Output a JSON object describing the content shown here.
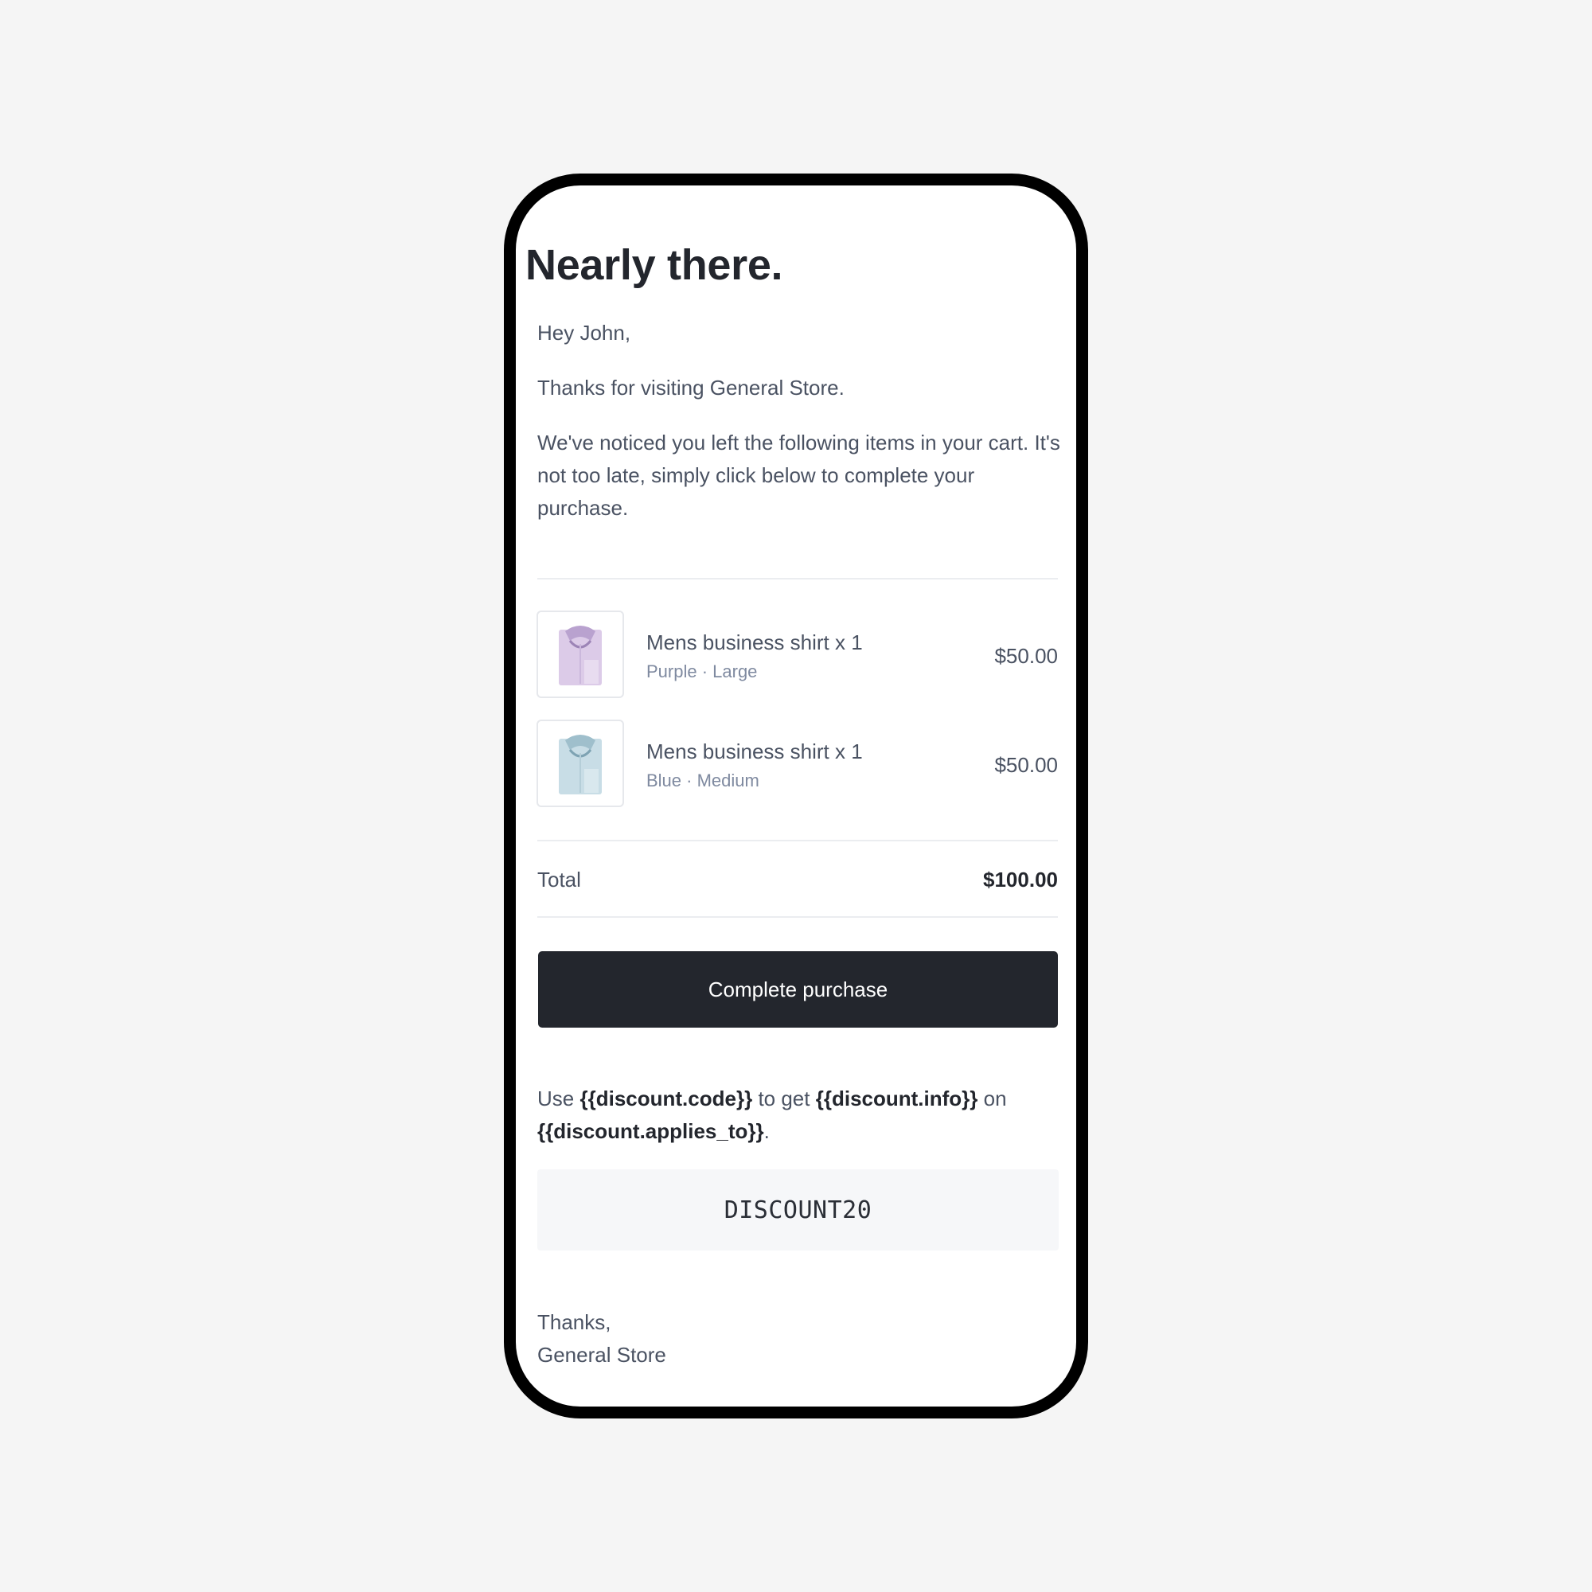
{
  "email": {
    "heading": "Nearly there.",
    "greeting": "Hey John,",
    "thanks_line": "Thanks for visiting General Store.",
    "body": "We've noticed you left the following items in your cart. It's not too late, simply click below to complete your purchase."
  },
  "cart": {
    "items": [
      {
        "name": "Mens business shirt x 1",
        "variant": "Purple · Large",
        "price": "$50.00",
        "image_icon": "purple-shirt-icon",
        "color": "#d9c8e6"
      },
      {
        "name": "Mens business shirt x 1",
        "variant": "Blue · Medium",
        "price": "$50.00",
        "image_icon": "blue-shirt-icon",
        "color": "#c9dde6"
      }
    ],
    "total_label": "Total",
    "total_value": "$100.00"
  },
  "cta": {
    "label": "Complete purchase"
  },
  "discount": {
    "use": "Use",
    "code_var": "{{discount.code}}",
    "to_get": "to get",
    "info_var": "{{discount.info}}",
    "on": "on",
    "applies_var": "{{discount.applies_to}}",
    "period": ".",
    "code": "DISCOUNT20"
  },
  "signoff": {
    "line1": "Thanks,",
    "line2": "General Store"
  },
  "colors": {
    "background": "#f5f5f5",
    "button": "#23262d",
    "text": "#4a5262",
    "muted": "#7f8aa0",
    "code_box": "#f6f7f9"
  }
}
